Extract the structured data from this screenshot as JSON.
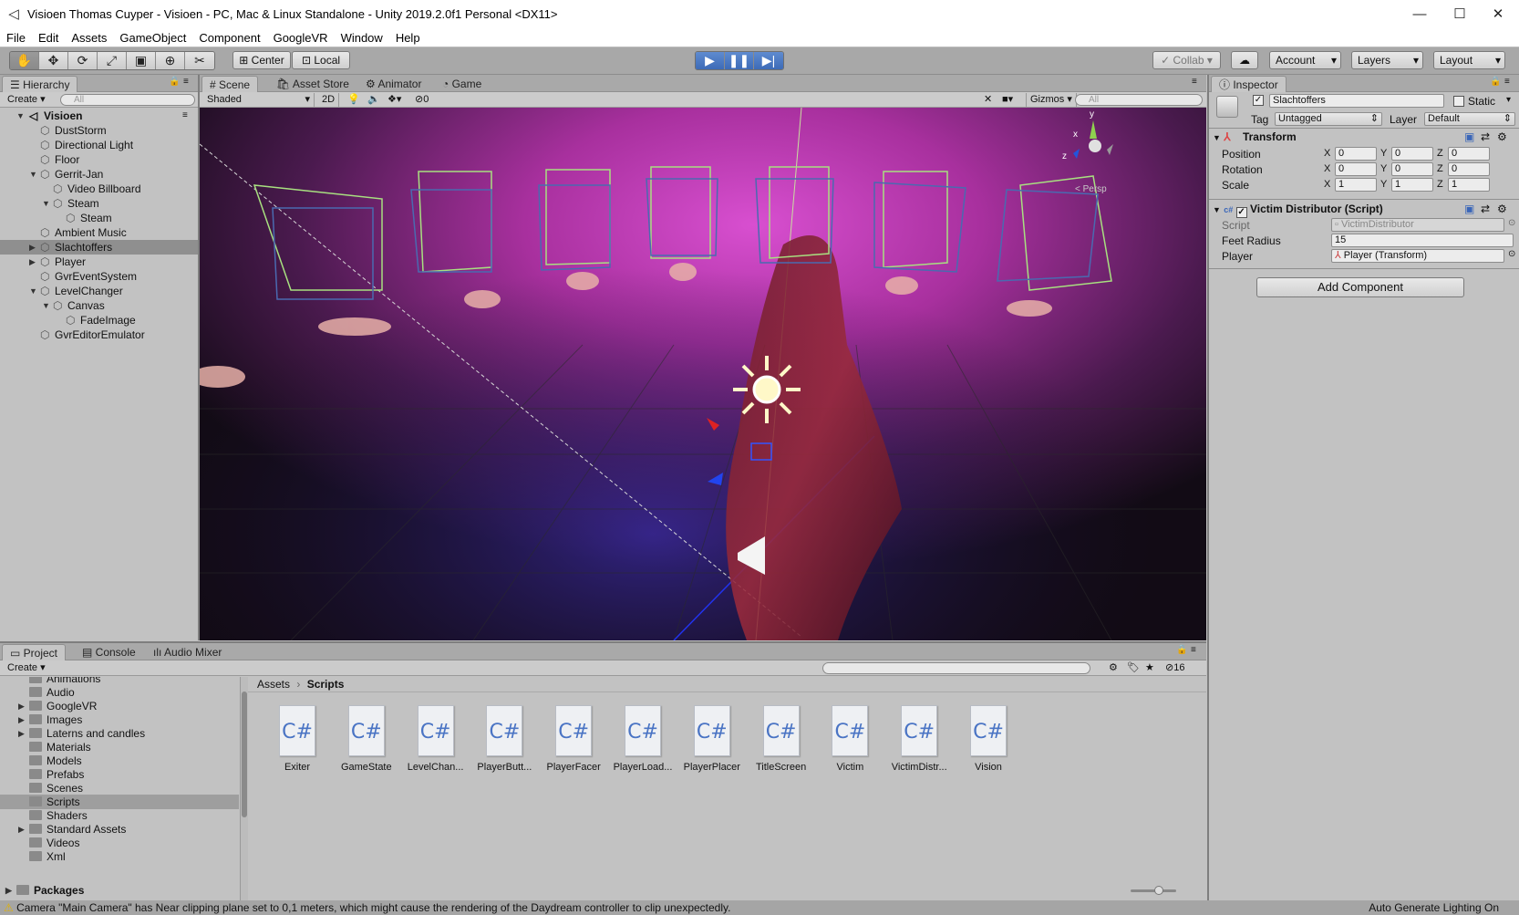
{
  "window": {
    "title": "Visioen Thomas Cuyper - Visioen - PC, Mac & Linux Standalone - Unity 2019.2.0f1 Personal <DX11>",
    "minimize": "—",
    "maximize": "☐",
    "close": "✕"
  },
  "menu": [
    "File",
    "Edit",
    "Assets",
    "GameObject",
    "Component",
    "GoogleVR",
    "Window",
    "Help"
  ],
  "toolbar": {
    "pivot": "Center",
    "space": "Local",
    "collab": "Collab",
    "account": "Account",
    "layers": "Layers",
    "layout": "Layout"
  },
  "hierarchy": {
    "tab": "Hierarchy",
    "create": "Create",
    "search_placeholder": "All",
    "scene": "Visioen",
    "items": [
      {
        "label": "DustStorm",
        "depth": 1,
        "expand": ""
      },
      {
        "label": "Directional Light",
        "depth": 1,
        "expand": ""
      },
      {
        "label": "Floor",
        "depth": 1,
        "expand": ""
      },
      {
        "label": "Gerrit-Jan",
        "depth": 1,
        "expand": "open"
      },
      {
        "label": "Video Billboard",
        "depth": 2,
        "expand": ""
      },
      {
        "label": "Steam",
        "depth": 2,
        "expand": "open"
      },
      {
        "label": "Steam",
        "depth": 3,
        "expand": ""
      },
      {
        "label": "Ambient Music",
        "depth": 1,
        "expand": ""
      },
      {
        "label": "Slachtoffers",
        "depth": 1,
        "expand": "closed",
        "selected": true
      },
      {
        "label": "Player",
        "depth": 1,
        "expand": "closed"
      },
      {
        "label": "GvrEventSystem",
        "depth": 1,
        "expand": ""
      },
      {
        "label": "LevelChanger",
        "depth": 1,
        "expand": "open"
      },
      {
        "label": "Canvas",
        "depth": 2,
        "expand": "open"
      },
      {
        "label": "FadeImage",
        "depth": 3,
        "expand": ""
      },
      {
        "label": "GvrEditorEmulator",
        "depth": 1,
        "expand": ""
      }
    ]
  },
  "scene_tabs": [
    "Scene",
    "Asset Store",
    "Animator",
    "Game"
  ],
  "scene_bar": {
    "shading": "Shaded",
    "mode2d": "2D",
    "hidden_count": "0",
    "gizmos": "Gizmos",
    "search_placeholder": "All",
    "persp": "< Persp",
    "axis_y": "y",
    "axis_z": "z",
    "axis_x": "x"
  },
  "inspector": {
    "tab": "Inspector",
    "object_name": "Slachtoffers",
    "static_label": "Static",
    "tag_label": "Tag",
    "tag_value": "Untagged",
    "layer_label": "Layer",
    "layer_value": "Default",
    "transform": {
      "title": "Transform",
      "rows": [
        {
          "label": "Position",
          "x": "0",
          "y": "0",
          "z": "0"
        },
        {
          "label": "Rotation",
          "x": "0",
          "y": "0",
          "z": "0"
        },
        {
          "label": "Scale",
          "x": "1",
          "y": "1",
          "z": "1"
        }
      ],
      "axis_x": "X",
      "axis_y": "Y",
      "axis_z": "Z"
    },
    "script_comp": {
      "title": "Victim Distributor (Script)",
      "script_label": "Script",
      "script_value": "VictimDistributor",
      "feet_label": "Feet Radius",
      "feet_value": "15",
      "player_label": "Player",
      "player_value": "Player (Transform)"
    },
    "add_component": "Add Component"
  },
  "project": {
    "tabs": [
      "Project",
      "Console",
      "Audio Mixer"
    ],
    "create": "Create",
    "count": "16",
    "breadcrumb_root": "Assets",
    "breadcrumb_current": "Scripts",
    "tree": [
      {
        "label": "Animations",
        "expand": ""
      },
      {
        "label": "Audio",
        "expand": ""
      },
      {
        "label": "GoogleVR",
        "expand": "closed"
      },
      {
        "label": "Images",
        "expand": "closed"
      },
      {
        "label": "Laterns and candles",
        "expand": "closed"
      },
      {
        "label": "Materials",
        "expand": ""
      },
      {
        "label": "Models",
        "expand": ""
      },
      {
        "label": "Prefabs",
        "expand": ""
      },
      {
        "label": "Scenes",
        "expand": ""
      },
      {
        "label": "Scripts",
        "expand": "",
        "selected": true
      },
      {
        "label": "Shaders",
        "expand": ""
      },
      {
        "label": "Standard Assets",
        "expand": "closed"
      },
      {
        "label": "Videos",
        "expand": ""
      },
      {
        "label": "Xml",
        "expand": ""
      }
    ],
    "packages": "Packages",
    "files": [
      "Exiter",
      "GameState",
      "LevelChan...",
      "PlayerButt...",
      "PlayerFacer",
      "PlayerLoad...",
      "PlayerPlacer",
      "TitleScreen",
      "Victim",
      "VictimDistr...",
      "Vision"
    ],
    "file_glyph": "C#"
  },
  "status": {
    "message": "Camera \"Main Camera\" has Near clipping plane set to 0,1 meters, which might cause the rendering of the Daydream controller to clip unexpectedly.",
    "right": "Auto Generate Lighting On"
  }
}
